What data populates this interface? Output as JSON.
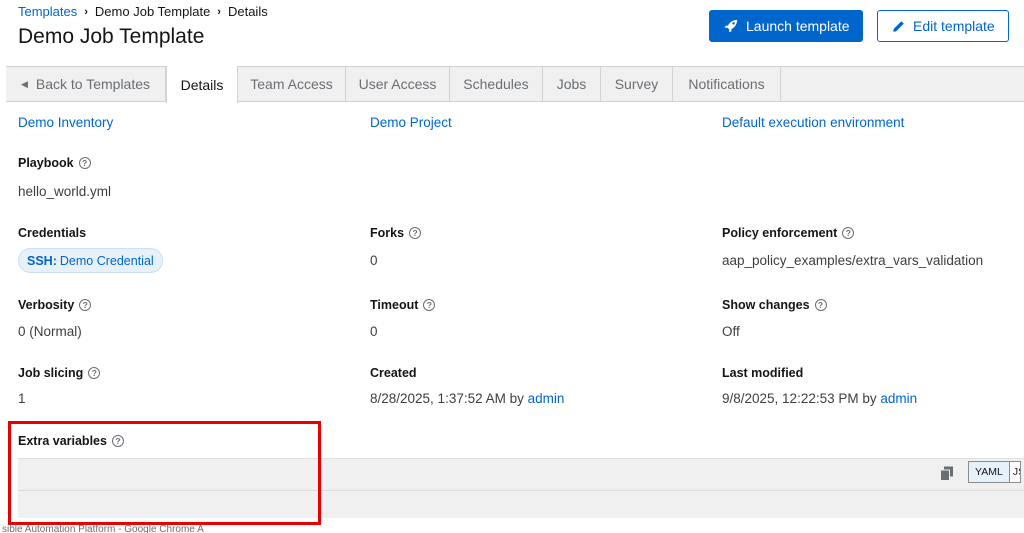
{
  "breadcrumb": {
    "root": "Templates",
    "middle": "Demo Job Template",
    "current": "Details"
  },
  "header": {
    "title": "Demo Job Template",
    "launch_label": "Launch template",
    "edit_label": "Edit template"
  },
  "tabs": {
    "back": "Back to Templates",
    "details": "Details",
    "team_access": "Team Access",
    "user_access": "User Access",
    "schedules": "Schedules",
    "jobs": "Jobs",
    "survey": "Survey",
    "notifications": "Notifications"
  },
  "details": {
    "inventory_value": "Demo Inventory",
    "project_value": "Demo Project",
    "execution_environment_value": "Default execution environment",
    "playbook_label": "Playbook",
    "playbook_value": "hello_world.yml",
    "credentials_label": "Credentials",
    "credential_type": "SSH:",
    "credential_name": "Demo Credential",
    "forks_label": "Forks",
    "forks_value": "0",
    "policy_label": "Policy enforcement",
    "policy_value": "aap_policy_examples/extra_vars_validation",
    "verbosity_label": "Verbosity",
    "verbosity_value": "0 (Normal)",
    "timeout_label": "Timeout",
    "timeout_value": "0",
    "show_changes_label": "Show changes",
    "show_changes_value": "Off",
    "job_slicing_label": "Job slicing",
    "job_slicing_value": "1",
    "created_label": "Created",
    "created_value": "8/28/2025, 1:37:52 AM by",
    "created_by": "admin",
    "modified_label": "Last modified",
    "modified_value": "9/8/2025, 12:22:53 PM by",
    "modified_by": "admin",
    "extra_vars_label": "Extra variables"
  },
  "editor": {
    "mode_yaml": "YAML",
    "mode_json": "JSON"
  },
  "window_caption": "sible Automation Platform - Google Chrome A",
  "colors": {
    "primary": "#0066cc",
    "highlight": "#e60000"
  }
}
